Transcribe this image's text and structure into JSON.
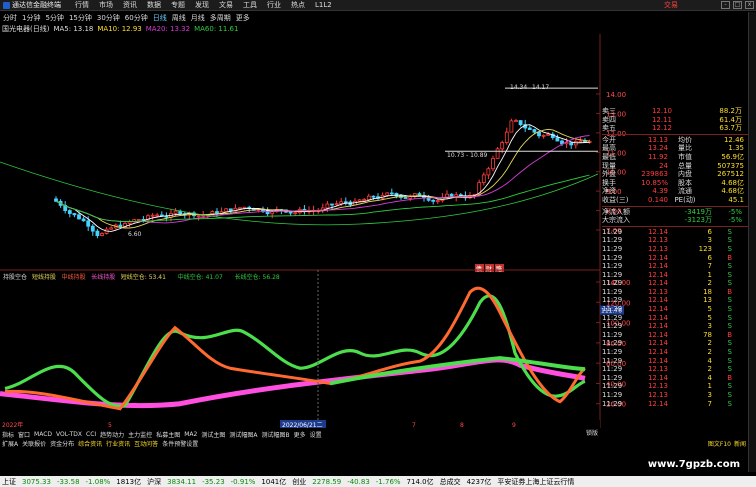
{
  "menubar": {
    "app_title": "通达信金融终端",
    "menu_items": [
      "行情",
      "市场",
      "资讯",
      "数据",
      "专题",
      "发现",
      "文易",
      "工具",
      "行业",
      "热点",
      "L1L2"
    ],
    "trade_label": "交易",
    "window_buttons": [
      "-",
      "□",
      "x"
    ]
  },
  "periodbar": {
    "items": [
      "分时",
      "1分钟",
      "5分钟",
      "15分钟",
      "30分钟",
      "60分钟",
      "日线",
      "周线",
      "月线",
      "多周期",
      "更多"
    ],
    "active_index": 6
  },
  "info": {
    "stock": "国光电器(日线)",
    "ma5": "MA5: 13.18",
    "ma10": "MA10: 12.93",
    "ma20": "MA20: 13.32",
    "ma60": "MA60: 11.61"
  },
  "main_chart": {
    "price_ticks": [
      "14.00",
      "13.00",
      "12.00",
      "11.00",
      "10.00",
      "9.00",
      "8.00",
      "7.00"
    ],
    "low_label": "6.60",
    "high_labels": [
      "14.34",
      "14.17"
    ],
    "range_label": "10.73 - 10.89",
    "ma_colors": {
      "ma5": "#ffffff",
      "ma10": "#e6d95b",
      "ma20": "#d63cd6",
      "ma60": "#2ecc40"
    }
  },
  "indicator": {
    "name": "持股空仓",
    "labels": [
      "短线持股",
      "中线持股",
      "长线持股",
      "短线空仓: 53.41",
      "中线空仓: 41.07",
      "长线空仓: 56.28"
    ],
    "ticks": [
      "140.00",
      "120.00",
      "100.00",
      "80.00",
      "60.00",
      "40.00",
      "20.00"
    ],
    "cursor_value": "111.76",
    "event_badges": [
      "债",
      "财",
      "略"
    ]
  },
  "date_axis": {
    "start_label": "2022年",
    "mid_label": "5",
    "cursor_label": "2022/06/21二",
    "labels": [
      "7",
      "8",
      "9"
    ]
  },
  "quote": {
    "sell_rows": [
      {
        "label": "卖三",
        "price": "12.10",
        "vol": "88.2万"
      },
      {
        "label": "卖四",
        "price": "12.11",
        "vol": "61.4万"
      },
      {
        "label": "卖五",
        "price": "12.12",
        "vol": "63.7万"
      }
    ],
    "stats": [
      {
        "l1": "今开",
        "v1": "13.13",
        "l2": "均价",
        "v2": "12.46"
      },
      {
        "l1": "最高",
        "v1": "13.24",
        "l2": "量比",
        "v2": "1.35"
      },
      {
        "l1": "最低",
        "v1": "11.92",
        "l2": "市值",
        "v2": "56.9亿"
      },
      {
        "l1": "现量",
        "v1": "24",
        "l2": "总量",
        "v2": "507375"
      },
      {
        "l1": "外盘",
        "v1": "239863",
        "l2": "内盘",
        "v2": "267512"
      },
      {
        "l1": "换手",
        "v1": "10.85%",
        "l2": "股本",
        "v2": "4.68亿"
      },
      {
        "l1": "净资",
        "v1": "4.39",
        "l2": "流通",
        "v2": "4.68亿"
      },
      {
        "l1": "收益(三)",
        "v1": "0.140",
        "l2": "PE(动)",
        "v2": "45.1"
      }
    ],
    "flows": [
      {
        "label": "净流入额",
        "value": "-3419万",
        "pct": "-5%"
      },
      {
        "label": "大宗流入",
        "value": "-3123万",
        "pct": "-5%"
      }
    ],
    "ticks": [
      {
        "time": "11:29",
        "price": "12.14",
        "vol": "6",
        "dir": "S"
      },
      {
        "time": "11:29",
        "price": "12.13",
        "vol": "3",
        "dir": "S"
      },
      {
        "time": "11:29",
        "price": "12.13",
        "vol": "123",
        "dir": "S"
      },
      {
        "time": "11:29",
        "price": "12.14",
        "vol": "6",
        "dir": "B"
      },
      {
        "time": "11:29",
        "price": "12.14",
        "vol": "7",
        "dir": "S"
      },
      {
        "time": "11:29",
        "price": "12.14",
        "vol": "1",
        "dir": "S"
      },
      {
        "time": "11:29",
        "price": "12.14",
        "vol": "2",
        "dir": "S"
      },
      {
        "time": "11:29",
        "price": "12.13",
        "vol": "18",
        "dir": "B"
      },
      {
        "time": "11:29",
        "price": "12.14",
        "vol": "13",
        "dir": "S"
      },
      {
        "time": "11:29",
        "price": "12.14",
        "vol": "5",
        "dir": "S"
      },
      {
        "time": "11:29",
        "price": "12.14",
        "vol": "5",
        "dir": "S"
      },
      {
        "time": "11:29",
        "price": "12.14",
        "vol": "3",
        "dir": "S"
      },
      {
        "time": "11:29",
        "price": "12.14",
        "vol": "78",
        "dir": "B"
      },
      {
        "time": "11:29",
        "price": "12.14",
        "vol": "2",
        "dir": "S"
      },
      {
        "time": "11:29",
        "price": "12.14",
        "vol": "2",
        "dir": "S"
      },
      {
        "time": "11:29",
        "price": "12.14",
        "vol": "4",
        "dir": "S"
      },
      {
        "time": "11:29",
        "price": "12.13",
        "vol": "2",
        "dir": "S"
      },
      {
        "time": "11:29",
        "price": "12.14",
        "vol": "4",
        "dir": "B"
      },
      {
        "time": "11:29",
        "price": "12.13",
        "vol": "1",
        "dir": "S"
      },
      {
        "time": "11:29",
        "price": "12.13",
        "vol": "3",
        "dir": "S"
      },
      {
        "time": "11:29",
        "price": "12.14",
        "vol": "7",
        "dir": "S"
      }
    ],
    "bottom_tab": "锁版"
  },
  "tabs_row1": [
    "指标",
    "窗口",
    "MACD",
    "VOL-TDX",
    "CCI",
    "趋势动力",
    "主力监控",
    "私募主图",
    "MA2",
    "测试主图",
    "测试幅图A",
    "测试幅图B",
    "更多",
    "设置"
  ],
  "tabs_row2": [
    "扩展A",
    "关联报价",
    "资金分布",
    "综合资讯",
    "行业资讯",
    "互动问答",
    "条件预警设置"
  ],
  "right_tabs": [
    "图文F10",
    "新闻"
  ],
  "status": {
    "items": [
      {
        "label": "上证",
        "v": "3075.33",
        "c": "-33.58",
        "p": "-1.08%",
        "amt": "1813亿"
      },
      {
        "label": "沪深",
        "v": "3834.11",
        "c": "-35.23",
        "p": "-0.91%",
        "amt": "1041亿"
      },
      {
        "label": "创业",
        "v": "2278.59",
        "c": "-40.83",
        "p": "-1.76%",
        "amt": "714.0亿"
      }
    ],
    "total": "总成交",
    "total_amt": "4237亿",
    "broker": "平安证券上海上证云行情"
  },
  "watermark": "www.7gpzb.com"
}
